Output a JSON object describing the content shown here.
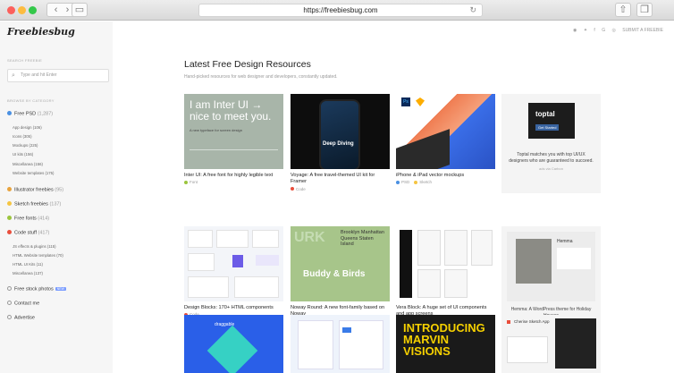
{
  "browser": {
    "url": "https://freebiesbug.com"
  },
  "site": {
    "logo": "Freebiesbug",
    "submit_label": "SUBMIT A FREEBIE"
  },
  "sidebar": {
    "search_label": "SEARCH FREEBIE",
    "search_placeholder": "Type and hit Enter",
    "browse_label": "BROWSE BY CATEGORY",
    "categories": [
      {
        "label": "Free PSD",
        "count": "(1,287)",
        "color": "#4a90e2",
        "subs": [
          {
            "label": "App design (106)"
          },
          {
            "label": "Icons (305)"
          },
          {
            "label": "Mockups (225)"
          },
          {
            "label": "UI kits (156)"
          },
          {
            "label": "Miscellanea (156)"
          },
          {
            "label": "Website templates (175)"
          }
        ]
      },
      {
        "label": "Illustrator freebies",
        "count": "(95)",
        "color": "#e8a33d"
      },
      {
        "label": "Sketch freebies",
        "count": "(137)",
        "color": "#f5c542"
      },
      {
        "label": "Free fonts",
        "count": "(414)",
        "color": "#9bc53d"
      },
      {
        "label": "Code stuff",
        "count": "(417)",
        "color": "#e94e3c",
        "subs": [
          {
            "label": "JS effects & plugins (115)"
          },
          {
            "label": "HTML Website templates (70)"
          },
          {
            "label": "HTML UI Kits (11)"
          },
          {
            "label": "Miscellanea (137)"
          }
        ]
      },
      {
        "label": "Free stock photos",
        "badge": "NEW",
        "color": "#ffffff"
      },
      {
        "label": "Contact me",
        "color": "#ffffff"
      },
      {
        "label": "Advertise",
        "color": "#ffffff"
      }
    ]
  },
  "main": {
    "title": "Latest Free Design Resources",
    "subtitle": "Hand-picked resources for web designer and developers, constantly updated.",
    "cards": [
      {
        "title": "Inter UI: A free font for highly legible text",
        "meta": [
          "Font"
        ],
        "colors": [
          "#9bc53d"
        ],
        "thumb_text": "I am Inter UI → nice to meet you.",
        "thumb_sub": "A new typeface for screen design"
      },
      {
        "title": "Voyage: A free travel-themed UI kit for Framer",
        "meta": [
          "Code"
        ],
        "colors": [
          "#e94e3c"
        ],
        "thumb_text": "Deep Diving"
      },
      {
        "title": "iPhone & iPad vector mockups",
        "meta": [
          "PSD",
          "Sketch"
        ],
        "colors": [
          "#4a90e2",
          "#f5c542"
        ]
      },
      {
        "title": "Toptal matches you with top UI/UX designers who are guaranteed to succeed.",
        "meta": [
          "ads via Carbon"
        ],
        "thumb_text": "toptal",
        "thumb_sub": "Get Started"
      },
      {
        "title": "Design Blocks: 170+ HTML components",
        "meta": [
          "Code"
        ],
        "colors": [
          "#e94e3c"
        ]
      },
      {
        "title": "Noway Round: A new font-family based on Noway",
        "meta": [
          "Font"
        ],
        "colors": [
          "#9bc53d"
        ],
        "thumb_text": "Buddy & Birds",
        "thumb_sub": "Brooklyn Manhattan Queens Staten Island"
      },
      {
        "title": "Vera Block: A huge set of UI components and app screens",
        "meta": [
          "PSD",
          "Sketch"
        ],
        "colors": [
          "#4a90e2",
          "#f5c542"
        ]
      },
      {
        "title": "Hemma: A WordPress theme for Holiday Houses",
        "meta": [],
        "thumb_text": "Hemma"
      },
      {
        "title": "",
        "meta": [],
        "thumb_text": "draggable"
      },
      {
        "title": "",
        "meta": []
      },
      {
        "title": "",
        "meta": [],
        "thumb_text": "INTRODUCING MARVIN VISIONS"
      },
      {
        "title": "",
        "meta": [],
        "thumb_text": "Cherise Sketch App"
      }
    ]
  }
}
